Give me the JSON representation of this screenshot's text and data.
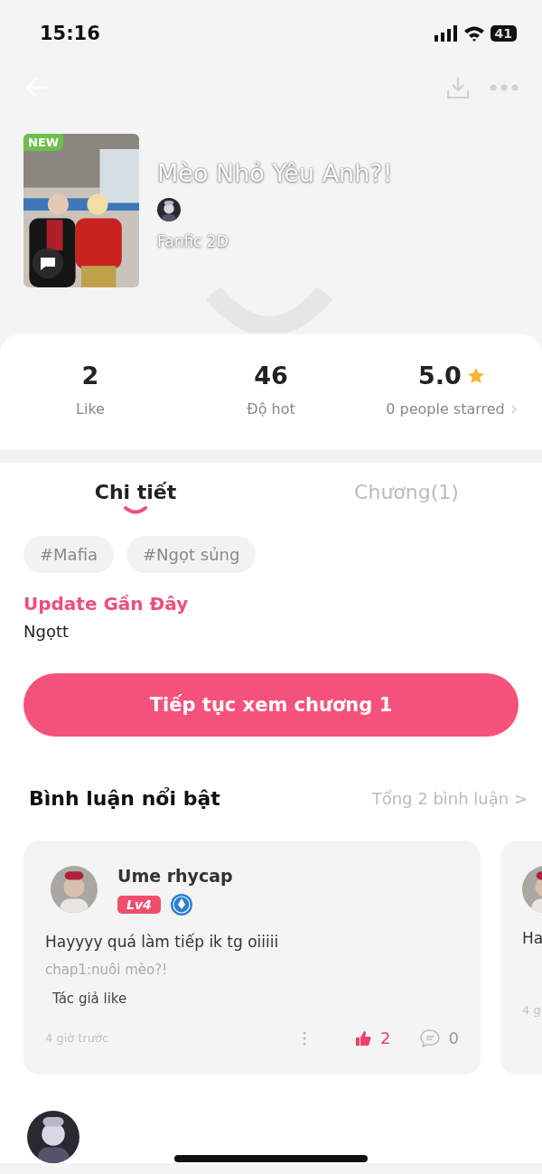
{
  "status_bar": {
    "time": "15:16",
    "battery": "41"
  },
  "cover": {
    "badge": "NEW"
  },
  "title": "Mèo Nhỏ Yêu Anh?!",
  "genre": "Fanfic 2D",
  "stats": [
    {
      "value": "2",
      "label": "Like",
      "kind": "plain"
    },
    {
      "value": "46",
      "label": "Độ hot",
      "kind": "plain"
    },
    {
      "value": "5.0",
      "label": "0 people starred",
      "kind": "rating"
    }
  ],
  "tabs": [
    {
      "label": "Chi tiết",
      "selected": true
    },
    {
      "label": "Chương(1)",
      "selected": false
    }
  ],
  "tags": [
    "#Mafia",
    "#Ngọt sủng"
  ],
  "update": {
    "heading": "Update Gần Đây",
    "text": "Ngọtt"
  },
  "continue_button": "Tiếp tục xem chương 1",
  "comments": {
    "heading": "Bình luận nổi bật",
    "total": "Tổng 2 bình luận >",
    "items": [
      {
        "user": "Ume rhycap",
        "level": "Lv4",
        "text": "Hayyyy quá làm tiếp ik tg oiiiii",
        "chapter": "chap1:nuôi mèo?!",
        "author_like": "Tác giả like",
        "time": "4 giờ trước",
        "likes": "2",
        "replies": "0",
        "liked": true
      },
      {
        "text": "Ha",
        "time": "4 g"
      }
    ]
  }
}
